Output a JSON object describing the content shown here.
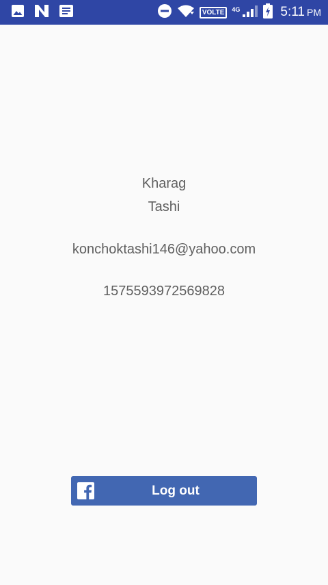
{
  "status_bar": {
    "background_color": "#2f46a5",
    "left_icons": [
      "image-icon",
      "n-logo-icon",
      "news-icon"
    ],
    "right_icons": [
      "do-not-disturb-icon",
      "wifi-icon",
      "signal-icon",
      "battery-charging-icon"
    ],
    "volte_label": "VOLTE",
    "network_type": "4G",
    "time": "5:11",
    "time_suffix": "PM"
  },
  "profile": {
    "first_name": "Kharag",
    "last_name": "Tashi",
    "email": "konchoktashi146@yahoo.com",
    "user_id": "1575593972569828",
    "text_color": "#5f5f5f"
  },
  "logout_button": {
    "label": "Log out",
    "icon": "facebook-f-icon",
    "background_color": "#4267b2"
  },
  "page": {
    "background_color": "#fafafa"
  }
}
